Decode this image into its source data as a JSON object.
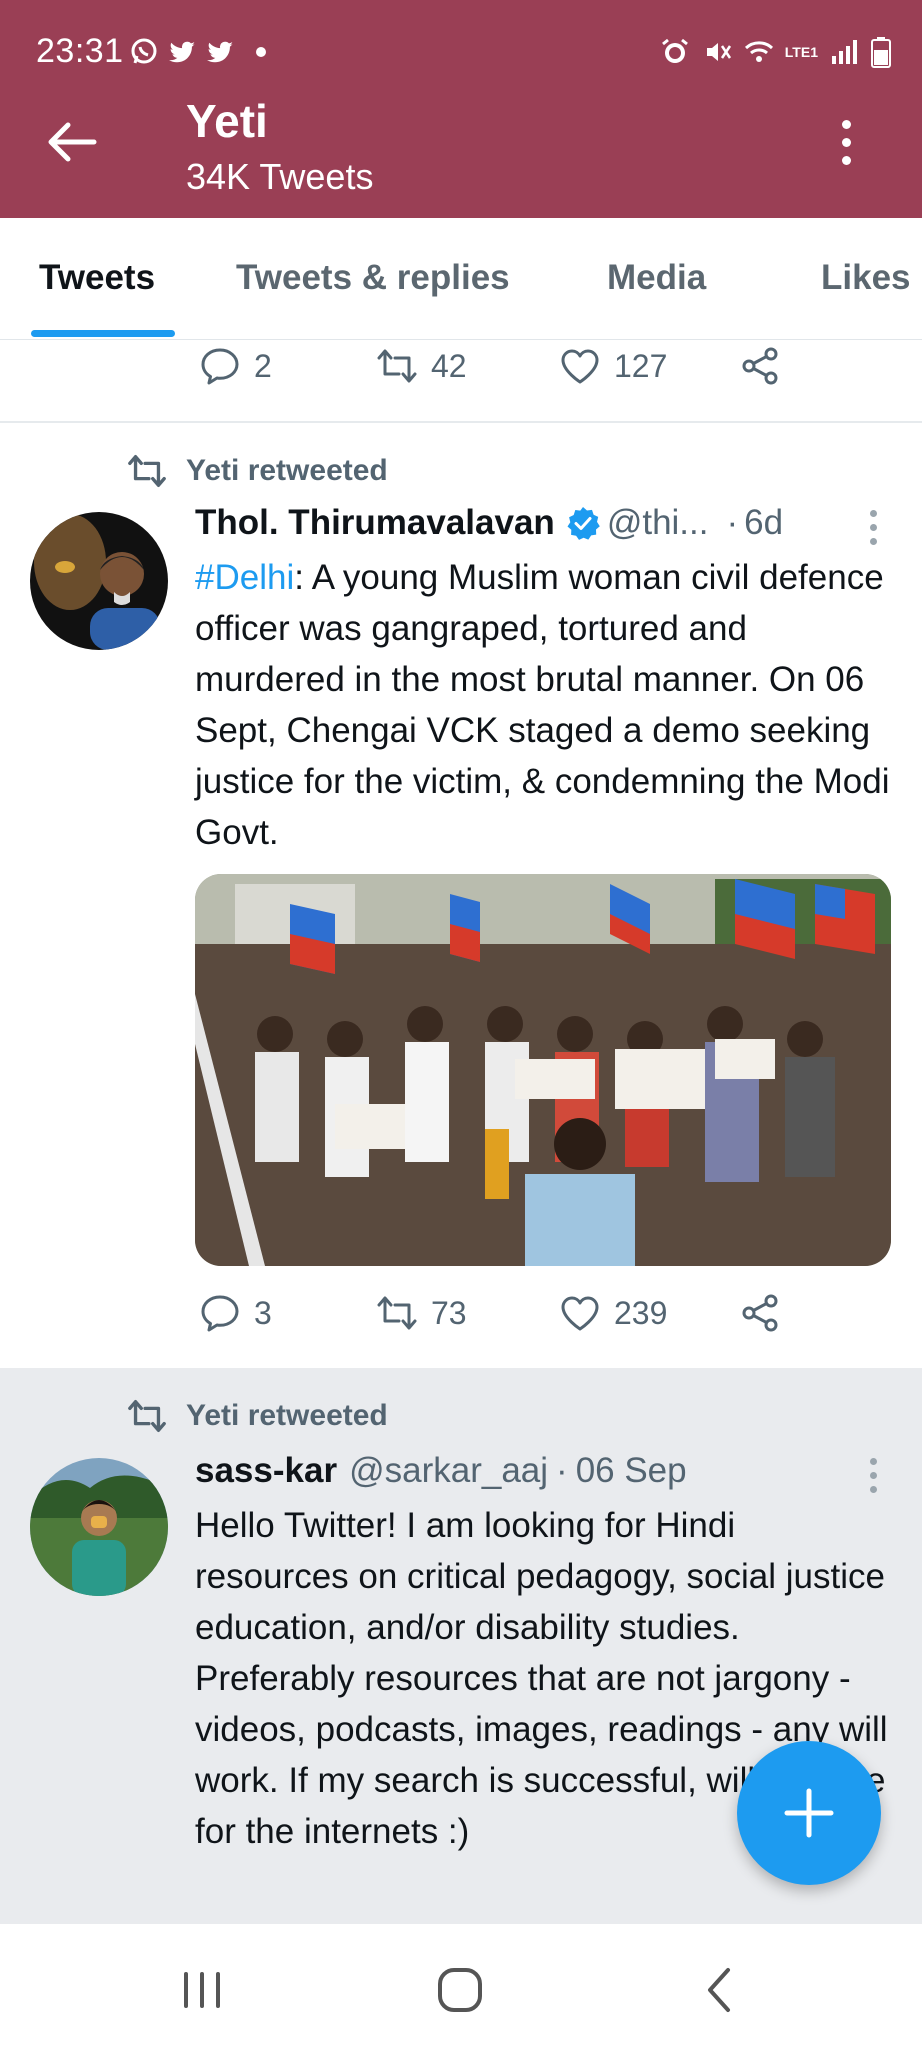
{
  "status_bar": {
    "time": "23:31",
    "network": "LTE1"
  },
  "header": {
    "title": "Yeti",
    "subtitle": "34K Tweets"
  },
  "tabs": [
    {
      "label": "Tweets",
      "active": true
    },
    {
      "label": "Tweets & replies",
      "active": false
    },
    {
      "label": "Media",
      "active": false
    },
    {
      "label": "Likes",
      "active": false
    }
  ],
  "top_actions": {
    "replies": "2",
    "retweets": "42",
    "likes": "127"
  },
  "tweet1": {
    "retweeted_by": "Yeti retweeted",
    "name": "Thol. Thirumavalavan",
    "handle": "@thi...",
    "separator": "·",
    "date": "6d",
    "hashtag": "#Delhi",
    "text": ": A young Muslim woman  civil defence officer was gangraped, tortured and murdered in the most brutal manner. On 06 Sept, Chengai VCK staged a demo seeking justice for the victim, & condemning the Modi Govt.",
    "replies": "3",
    "retweets": "73",
    "likes": "239"
  },
  "tweet2": {
    "retweeted_by": "Yeti retweeted",
    "name": "sass-kar",
    "handle": "@sarkar_aaj",
    "separator": "·",
    "date": "06 Sep",
    "text": "Hello Twitter! I am looking for Hindi resources on critical pedagogy, social justice education, and/or disability studies. Preferably resources that are not jargony - videos, podcasts, images, readings - any will work. If my search is successful, will compile for the internets :)"
  },
  "colors": {
    "header": "#9a3f55",
    "accent": "#1d9bf0",
    "muted": "#536471"
  }
}
